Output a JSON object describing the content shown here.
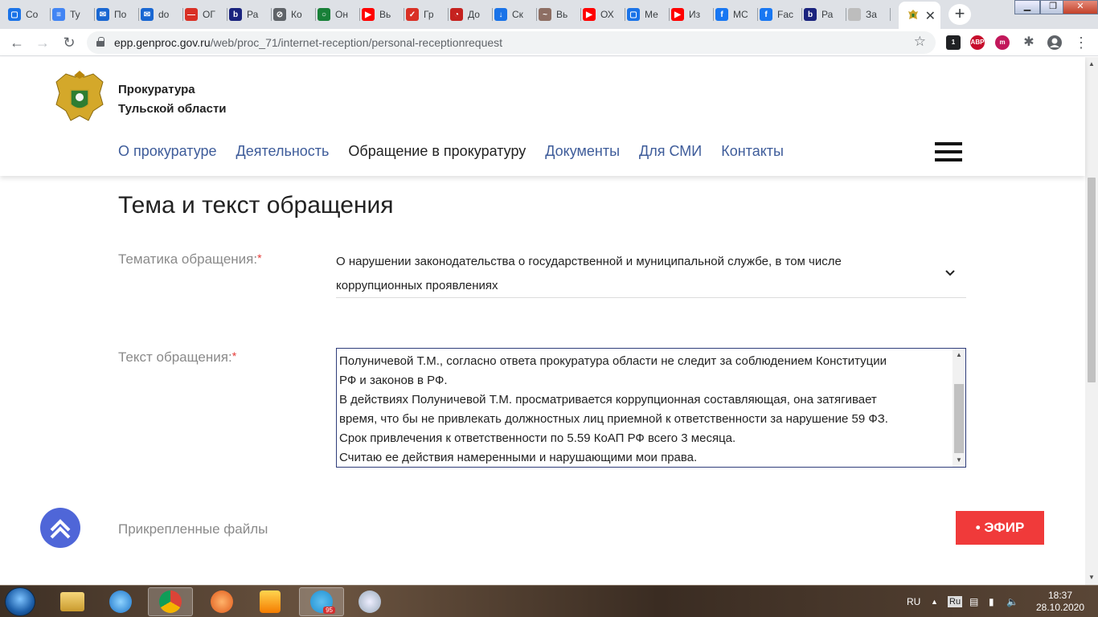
{
  "browser": {
    "tabs": [
      {
        "label": "Co",
        "color": "#1a73e8",
        "glyph": "▢"
      },
      {
        "label": "Ту",
        "color": "#4285f4",
        "glyph": "≡"
      },
      {
        "label": "По",
        "color": "#1967d2",
        "glyph": "✉"
      },
      {
        "label": "do",
        "color": "#1967d2",
        "glyph": "✉"
      },
      {
        "label": "ОГ",
        "color": "#d93025",
        "glyph": "—"
      },
      {
        "label": "Ра",
        "color": "#1a237e",
        "glyph": "b"
      },
      {
        "label": "Ко",
        "color": "#5f6368",
        "glyph": "⊘"
      },
      {
        "label": "Он",
        "color": "#188038",
        "glyph": "○"
      },
      {
        "label": "Вь",
        "color": "#ff0000",
        "glyph": "▶"
      },
      {
        "label": "Гр",
        "color": "#d93025",
        "glyph": "✓"
      },
      {
        "label": "До",
        "color": "#c5221f",
        "glyph": "◔"
      },
      {
        "label": "Ск",
        "color": "#1a73e8",
        "glyph": "↓"
      },
      {
        "label": "Вь",
        "color": "#8d6e63",
        "glyph": "~"
      },
      {
        "label": "ОХ",
        "color": "#ff0000",
        "glyph": "▶"
      },
      {
        "label": "Ме",
        "color": "#1a73e8",
        "glyph": "▢"
      },
      {
        "label": "Из",
        "color": "#ff0000",
        "glyph": "▶"
      },
      {
        "label": "МС",
        "color": "#1877f2",
        "glyph": "f"
      },
      {
        "label": "Fac",
        "color": "#1877f2",
        "glyph": "f"
      },
      {
        "label": "Ра",
        "color": "#1a237e",
        "glyph": "b"
      },
      {
        "label": "За",
        "color": "#bdbdbd",
        "glyph": " "
      }
    ],
    "active_tab_icon": "emblem-icon",
    "url_host": "epp.genproc.gov.ru",
    "url_path": "/web/proc_71/internet-reception/personal-receptionrequest",
    "extensions": [
      {
        "name": "extension-badge-icon",
        "text": "1",
        "color": "#202124"
      },
      {
        "name": "adblock-icon",
        "text": "ABP",
        "color": "#c70d2c"
      },
      {
        "name": "mc-extension-icon",
        "text": "m",
        "color": "#c2185b"
      }
    ]
  },
  "site": {
    "org_line1": "Прокуратура",
    "org_line2": "Тульской области",
    "nav": [
      {
        "label": "О прокуратуре",
        "current": false
      },
      {
        "label": "Деятельность",
        "current": false
      },
      {
        "label": "Обращение в прокуратуру",
        "current": true
      },
      {
        "label": "Документы",
        "current": false
      },
      {
        "label": "Для СМИ",
        "current": false
      },
      {
        "label": "Контакты",
        "current": false
      }
    ]
  },
  "form": {
    "section_title": "Тема и текст обращения",
    "topic_label": "Тематика обращения:",
    "topic_value": "О нарушении законодательства о государственной и муниципальной службе, в том числе коррупционных проявлениях",
    "text_label": "Текст обращения:",
    "text_lines": [
      "Полуничевой Т.М., согласно ответа прокуратура области не следит за соблюдением Конституции",
      "РФ и законов в РФ.",
      "В действиях Полуничевой Т.М. просматривается коррупционная составляющая, она затягивает",
      "время, что бы не привлекать должностных лиц приемной к ответственности за нарушение 59 ФЗ.",
      "Срок привлечения к ответственности по 5.59 КоАП РФ всего 3 месяца.",
      "Считаю ее действия намеренными и нарушающими мои права."
    ],
    "required_mark": "*",
    "attachments_label": "Прикрепленные файлы"
  },
  "live_button": "• ЭФИР",
  "taskbar": {
    "language": "RU",
    "lang_indicator": "Ru",
    "time": "18:37",
    "date": "28.10.2020",
    "telegram_badge": "95"
  }
}
